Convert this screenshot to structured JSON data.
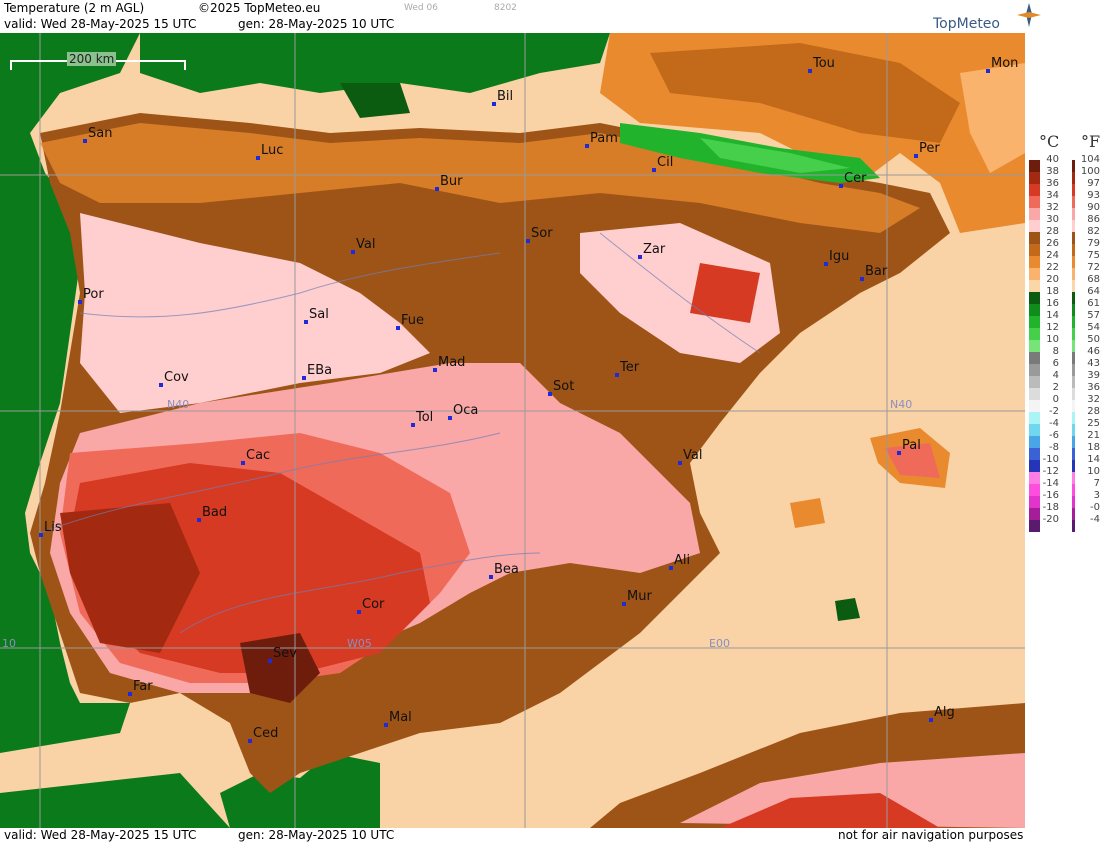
{
  "header": {
    "title": "Temperature (2 m AGL)",
    "copyright": "©2025 TopMeteo.eu",
    "frame": "Wed 06",
    "code": "8202",
    "valid": "valid:  Wed  28-May-2025  15 UTC",
    "gen": "gen: 28-May-2025 10 UTC"
  },
  "footer": {
    "valid": "valid:  Wed  28-May-2025  15 UTC",
    "gen": "gen: 28-May-2025 10 UTC",
    "disclaimer": "not for air navigation purposes"
  },
  "logo": {
    "text": "TopMeteo"
  },
  "scale_bar": {
    "label": "200 km"
  },
  "gridlines": {
    "lat_labels": [
      "N40"
    ],
    "lon_labels": [
      "10",
      "W05",
      "E00"
    ]
  },
  "legend": {
    "unit_c": "°C",
    "unit_f": "°F",
    "celsius": [
      "40",
      "38",
      "36",
      "34",
      "32",
      "30",
      "28",
      "26",
      "24",
      "22",
      "20",
      "18",
      "16",
      "14",
      "12",
      "10",
      "8",
      "6",
      "4",
      "2",
      "0",
      "-2",
      "-4",
      "-6",
      "-8",
      "-10",
      "-12",
      "-14",
      "-16",
      "-18",
      "-20"
    ],
    "fahrenheit": [
      "104",
      "100",
      "97",
      "93",
      "90",
      "86",
      "82",
      "79",
      "75",
      "72",
      "68",
      "64",
      "61",
      "57",
      "54",
      "50",
      "46",
      "43",
      "39",
      "36",
      "32",
      "28",
      "25",
      "21",
      "18",
      "14",
      "10",
      "7",
      "3",
      "-0",
      "-4"
    ],
    "colors": [
      "#6e1d0c",
      "#a32a10",
      "#d63a22",
      "#f06a5a",
      "#f9a7a7",
      "#ffcfcf",
      "#9e5417",
      "#c2691a",
      "#ea8a2e",
      "#f9b36d",
      "#fbd6a8",
      "#0b5b10",
      "#0f8c1b",
      "#22b32c",
      "#45cf4b",
      "#77e47a",
      "#7a7a7a",
      "#9a9a9a",
      "#bbbbbb",
      "#dcdcdc",
      "#f4f4f4",
      "#a9f4f5",
      "#6fd7ee",
      "#4aa5e6",
      "#3a62d4",
      "#2534b8",
      "#ff7ee6",
      "#ff4ddd",
      "#e233cc",
      "#a51d99",
      "#5a1a6e"
    ]
  },
  "cities": [
    {
      "name": "Tou"
    },
    {
      "name": "Mon"
    },
    {
      "name": "Bil"
    },
    {
      "name": "San"
    },
    {
      "name": "Pam"
    },
    {
      "name": "Luc"
    },
    {
      "name": "Per"
    },
    {
      "name": "Cil"
    },
    {
      "name": "Bur"
    },
    {
      "name": "Cer"
    },
    {
      "name": "Sor"
    },
    {
      "name": "Val"
    },
    {
      "name": "Zar"
    },
    {
      "name": "Igu"
    },
    {
      "name": "Bar"
    },
    {
      "name": "Por"
    },
    {
      "name": "Sal"
    },
    {
      "name": "Fue"
    },
    {
      "name": "EBa"
    },
    {
      "name": "Mad"
    },
    {
      "name": "Ter"
    },
    {
      "name": "Cov"
    },
    {
      "name": "Sot"
    },
    {
      "name": "Tol"
    },
    {
      "name": "Oca"
    },
    {
      "name": "Pal"
    },
    {
      "name": "Cac"
    },
    {
      "name": "Val"
    },
    {
      "name": "Bad"
    },
    {
      "name": "Lis"
    },
    {
      "name": "Bea"
    },
    {
      "name": "Ali"
    },
    {
      "name": "Cor"
    },
    {
      "name": "Mur"
    },
    {
      "name": "Sev"
    },
    {
      "name": "Far"
    },
    {
      "name": "Alg"
    },
    {
      "name": "Mal"
    },
    {
      "name": "Ced"
    }
  ],
  "colors": {
    "sea": "#f9d3a6",
    "land_green": "#0a7a1a",
    "dark_green": "#0b5b10",
    "city_dot": "#1f2bd9"
  }
}
